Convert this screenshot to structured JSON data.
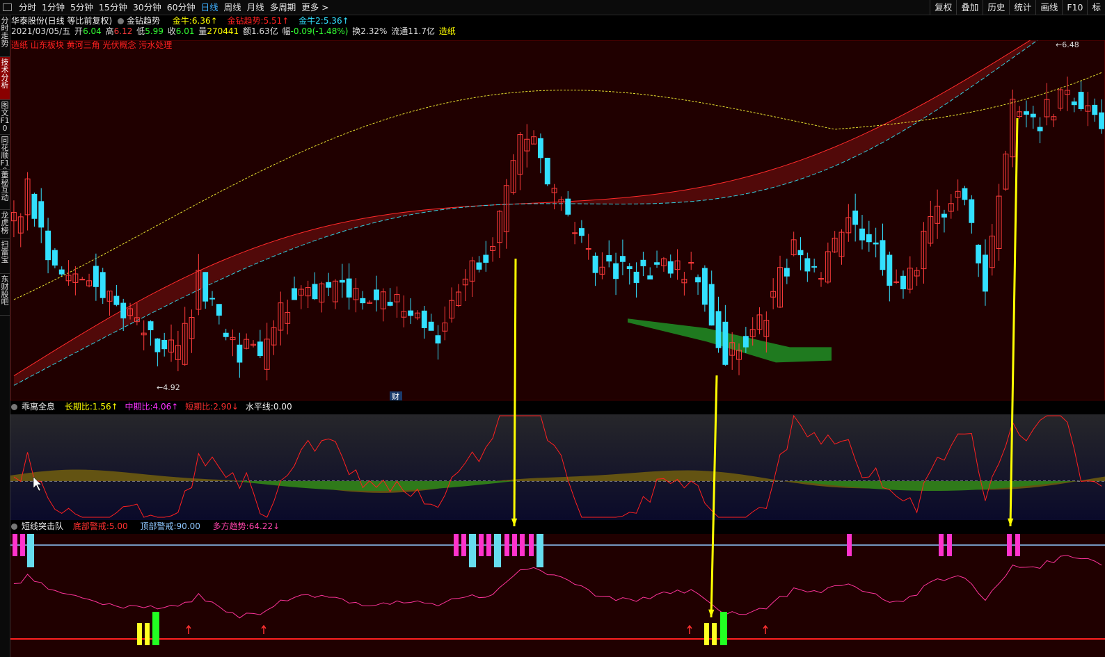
{
  "toolbar": {
    "periods": [
      "分时",
      "1分钟",
      "5分钟",
      "15分钟",
      "30分钟",
      "60分钟",
      "日线",
      "周线",
      "月线",
      "多周期",
      "更多 >"
    ],
    "active": "日线",
    "right": [
      "复权",
      "叠加",
      "历史",
      "统计",
      "画线",
      "F10",
      "标"
    ]
  },
  "sidebar": {
    "tabs": [
      "分时走势",
      "技术分析",
      "图文F10",
      "同花顺F10",
      "董秘互动",
      "龙虎榜",
      "扫雷宝",
      "东财股吧"
    ],
    "active": "技术分析"
  },
  "stock": {
    "title": "华泰股份(日线 等比前复权)",
    "indicator": "金钻趋势",
    "gold1_label": "金牛:",
    "gold1_value": "6.36↑",
    "trend_label": "金钻趋势:",
    "trend_value": "5.51↑",
    "gold2_label": "金牛2:",
    "gold2_value": "5.36↑",
    "date": "2021/03/05/五",
    "open_label": "开",
    "open": "6.04",
    "high_label": "高",
    "high": "6.12",
    "low_label": "低",
    "low": "5.99",
    "close_label": "收",
    "close": "6.01",
    "vol_label": "量",
    "vol": "270441",
    "amount_label": "额",
    "amount": "1.63亿",
    "change_label": "幅",
    "change": "-0.09(-1.48%)",
    "turnover_label": "换",
    "turnover": "2.32%",
    "float_label": "流通",
    "float": "11.7亿",
    "sector": "造纸"
  },
  "tags": "造纸 山东板块 黄河三角 光伏概念 污水处理",
  "main_chart": {
    "high_label": "6.48",
    "low_label": "4.92",
    "cai": "财"
  },
  "panel2": {
    "name": "乖离全息",
    "long_label": "长期比:",
    "long_value": "1.56↑",
    "mid_label": "中期比:",
    "mid_value": "4.06↑",
    "short_label": "短期比:",
    "short_value": "2.90↓",
    "level_label": "水平线:",
    "level_value": "0.00"
  },
  "panel3": {
    "name": "短线突击队",
    "bottom_label": "底部警戒:",
    "bottom_value": "5.00",
    "top_label": "顶部警戒:",
    "top_value": "90.00",
    "bull_label": "多方趋势:",
    "bull_value": "64.22↓"
  },
  "colors": {
    "up": "#ff3b3b",
    "down": "#33e0ff",
    "ma": "#e8e030",
    "bg_main": "#250000",
    "arrow": "#ffff00"
  }
}
